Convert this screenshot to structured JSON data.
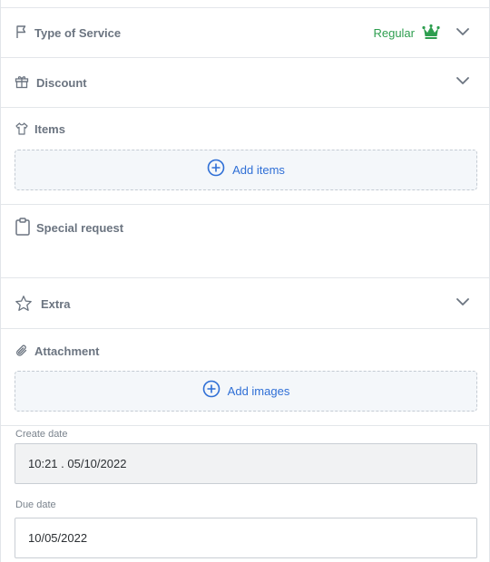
{
  "sections": {
    "type_of_service": {
      "label": "Type of Service",
      "value": "Regular"
    },
    "discount": {
      "label": "Discount"
    },
    "items": {
      "label": "Items",
      "add_label": "Add items"
    },
    "special_request": {
      "label": "Special request"
    },
    "extra": {
      "label": "Extra"
    },
    "attachment": {
      "label": "Attachment",
      "add_label": "Add images"
    }
  },
  "dates": {
    "create_label": "Create date",
    "create_value": "10:21 . 05/10/2022",
    "due_label": "Due date",
    "due_value": "10/05/2022"
  },
  "icons": {
    "type_of_service": "flag-icon",
    "discount": "gift-icon",
    "items": "shirt-icon",
    "special_request": "clipboard-icon",
    "extra": "star-icon",
    "attachment": "paperclip-icon",
    "add": "plus-circle-icon",
    "chevron": "chevron-down-icon",
    "premium": "crown-icon"
  },
  "colors": {
    "accent_blue": "#2f6fd6",
    "regular_green": "#2e9e4f",
    "label_gray": "#6b7480"
  }
}
